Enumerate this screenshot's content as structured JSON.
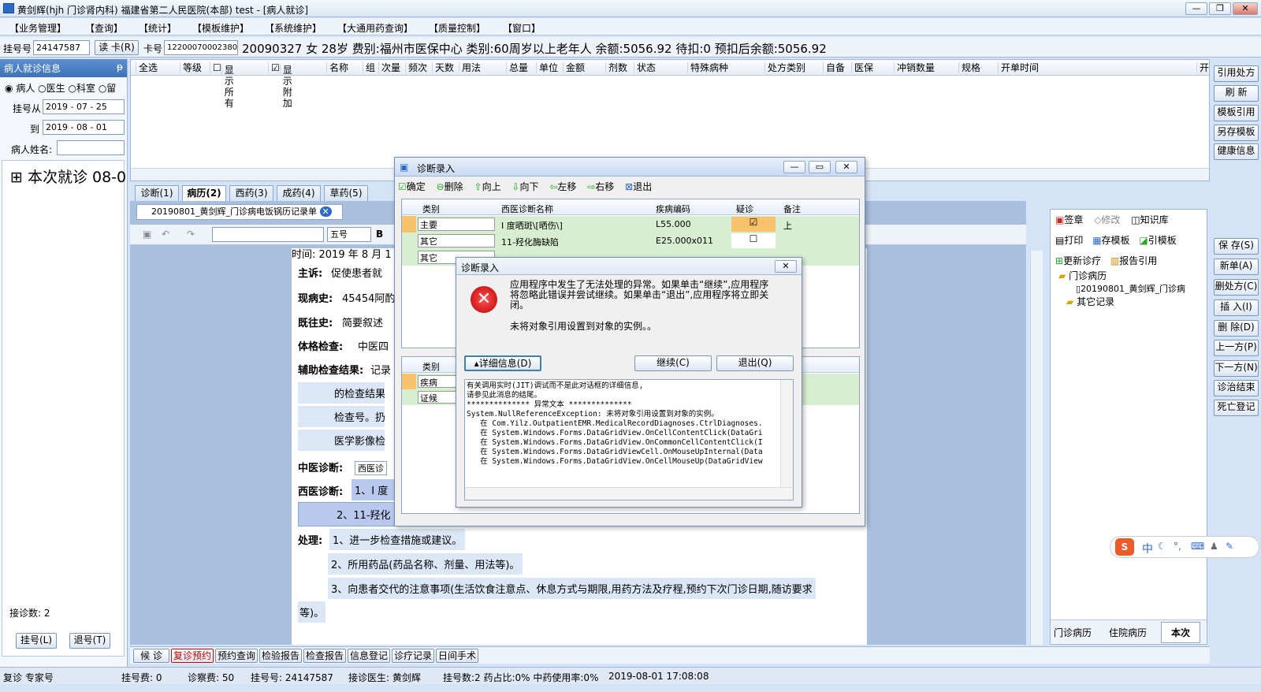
{
  "window": {
    "title": "黄剑辉(hjh 门诊肾内科) 福建省第二人民医院(本部) test - [病人就诊]"
  },
  "menu": [
    "【业务管理】",
    "【查询】",
    "【统计】",
    "【模板维护】",
    "【系统维护】",
    "【大通用药查询】",
    "【质量控制】",
    "【窗口】"
  ],
  "patient": {
    "reg_label": "挂号号",
    "reg_no": "24147587",
    "read_card": "读 卡(R)",
    "card_label": "卡号",
    "card_no": "1220007000238099",
    "info": "20090327 女 28岁 费别:福州市医保中心 类别:60周岁以上老年人 余额:5056.92 待扣:0 预扣后余额:5056.92"
  },
  "left_panel": {
    "title": "病人就诊信息",
    "radio_patient": "病人",
    "radio_doctor": "医生",
    "radio_dept": "科室",
    "radio_extra": "留",
    "from_label": "挂号从",
    "from_date": "2019 - 07 - 25",
    "to_label": "到",
    "to_date": "2019 - 08 - 01",
    "name_label": "病人姓名:",
    "tree_item": "本次就诊 08-0",
    "count": "接诊数: 2",
    "btn_reg": "挂号(L)",
    "btn_unreg": "退号(T)"
  },
  "grid_headers": [
    "全选",
    "等级",
    "显示所有",
    "显示附加",
    "名称",
    "组",
    "次量",
    "频次",
    "天数",
    "用法",
    "总量",
    "单位",
    "金额",
    "剂数",
    "状态",
    "特殊病种",
    "处方类别",
    "自备",
    "医保",
    "冲销数量",
    "规格",
    "开单时间",
    "开"
  ],
  "right_toolbar": [
    "引用处方",
    "刷 新",
    "模板引用",
    "另存模板",
    "健康信息",
    "保 存(S)",
    "新单(A)",
    "删处方(C)",
    "插 入(I)",
    "删 除(D)",
    "上一方(P)",
    "下一方(N)",
    "诊治结束",
    "死亡登记"
  ],
  "tabs": [
    "诊断(1)",
    "病历(2)",
    "西药(3)",
    "成药(4)",
    "草药(5)"
  ],
  "doc_tab": "20190801_黄剑辉_门诊病电饭锅历记录单",
  "font": {
    "name": "",
    "size": "五号"
  },
  "record": {
    "time": "时间: 2019 年 8 月 1",
    "chief_label": "主诉:",
    "chief": "促使患者就",
    "present_label": "现病史:",
    "present": "45454阿酌",
    "past_label": "既往史:",
    "past": "简要叙述",
    "exam_label": "体格检查:",
    "exam": "中医四",
    "aux_label": "辅助检查结果:",
    "aux": "记录",
    "aux2": "的检查结果",
    "aux3": "检查号。扔",
    "aux4": "医学影像检",
    "tcm_label": "中医诊断:",
    "tcm": "西医诊",
    "wm_label": "西医诊断:",
    "wm1": "1、I 度",
    "wm2": "2、11-羟化",
    "treat_label": "处理:",
    "treat1": "1、进一步检查措施或建议。",
    "treat2": "2、所用药品(药品名称、剂量、用法等)。",
    "treat3": "3、向患者交代的注意事项(生活饮食注意点、休息方式与期限,用药方法及疗程,预约下次门诊日期,随访要求",
    "treat4": "等)。"
  },
  "right_panel": {
    "sign": "签章",
    "modify": "修改",
    "kb": "知识库",
    "print": "打印",
    "save_tpl": "存模板",
    "cite_tpl": "引模板",
    "update": "更新诊疗",
    "report": "报告引用",
    "tree_root": "门诊病历",
    "tree_child": "20190801_黄剑辉_门诊病",
    "tree_other": "其它记录",
    "tab1": "门诊病历",
    "tab2": "住院病历",
    "tab3": "本次"
  },
  "diag_dialog": {
    "title": "诊断录入",
    "tools": [
      "确定",
      "删除",
      "向上",
      "向下",
      "左移",
      "右移",
      "退出"
    ],
    "headers": [
      "类别",
      "西医诊断名称",
      "疾病编码",
      "疑诊",
      "备注"
    ],
    "rows": [
      {
        "cat": "主要",
        "name": "I 度晒斑\\[晒伤\\]",
        "code": "L55.000",
        "note": "上"
      },
      {
        "cat": "其它",
        "name": "11-羟化酶缺陷",
        "code": "E25.000x011",
        "note": ""
      },
      {
        "cat": "其它",
        "name": "",
        "code": "",
        "note": ""
      }
    ],
    "lower_header": "类别",
    "lower_rows": [
      "疾病",
      "证候"
    ]
  },
  "error_dialog": {
    "title": "诊断录入",
    "message": "应用程序中发生了无法处理的异常。如果单击“继续”,应用程序将忽略此错误并尝试继续。如果单击“退出”,应用程序将立即关闭。",
    "sub": "未将对象引用设置到对象的实例。。",
    "details_btn": "详细信息(D)",
    "continue_btn": "继续(C)",
    "quit_btn": "退出(Q)",
    "details": [
      "有关调用实时(JIT)调试而不是此对话框的详细信息,",
      "请参见此消息的结尾。",
      "",
      "************** 异常文本 **************",
      "System.NullReferenceException: 未将对象引用设置到对象的实例。",
      "   在 Com.Yilz.OutpatientEMR.MedicalRecordDiagnoses.CtrlDiagnoses.",
      "   在 System.Windows.Forms.DataGridView.OnCellContentClick(DataGri",
      "   在 System.Windows.Forms.DataGridView.OnCommonCellContentClick(I",
      "   在 System.Windows.Forms.DataGridViewCell.OnMouseUpInternal(Data",
      "   在 System.Windows.Forms.DataGridView.OnCellMouseUp(DataGridView"
    ]
  },
  "bottom_buttons": [
    "候 诊",
    "复诊预约",
    "预约查询",
    "检验报告",
    "检查报告",
    "信息登记",
    "诊疗记录",
    "日间手术"
  ],
  "status": {
    "a": "复诊 专家号",
    "b": "挂号费: 0",
    "c": "诊察费: 50",
    "d": "挂号号: 24147587",
    "e": "接诊医生: 黄剑辉",
    "f": "挂号数:2 药占比:0% 中药使用率:0%",
    "g": "2019-08-01 17:08:08"
  },
  "ime": {
    "label": "中"
  }
}
